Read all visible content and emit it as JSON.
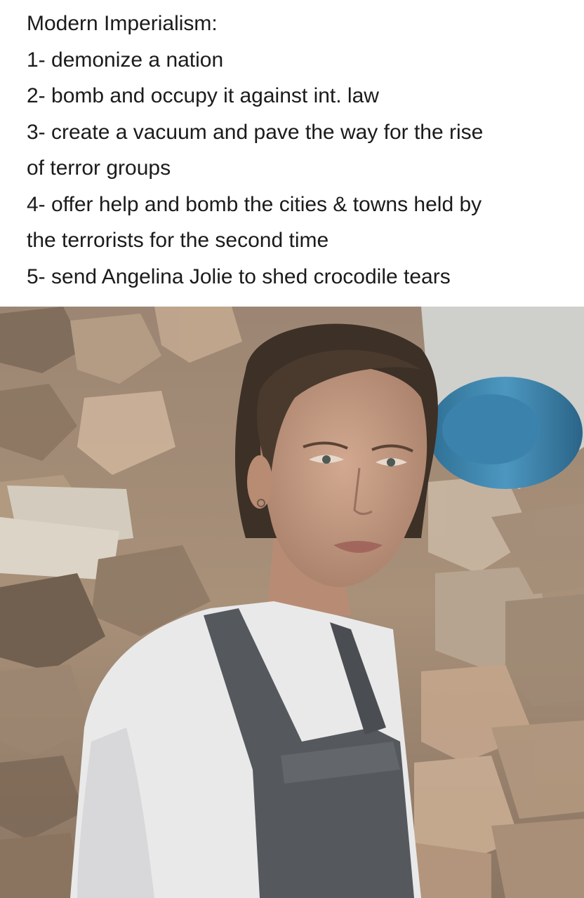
{
  "caption": {
    "title": "Modern Imperialism:",
    "lines": [
      "1- demonize a nation",
      "2- bomb and occupy it against int. law",
      "3- create a vacuum and pave the way for the rise",
      "of terror groups",
      "4- offer help and bomb the cities & towns held by",
      "the terrorists for the second time",
      "5- send Angelina Jolie to shed crocodile tears"
    ]
  },
  "photo": {
    "subject": "woman in rubble",
    "colors": {
      "rubble": "#a8917a",
      "rubble_dark": "#6e5d4d",
      "barrel": "#3f86ad",
      "shirt": "#e9e9ea",
      "apron": "#55595e",
      "skin": "#c49a82",
      "hair": "#3d3026"
    }
  }
}
